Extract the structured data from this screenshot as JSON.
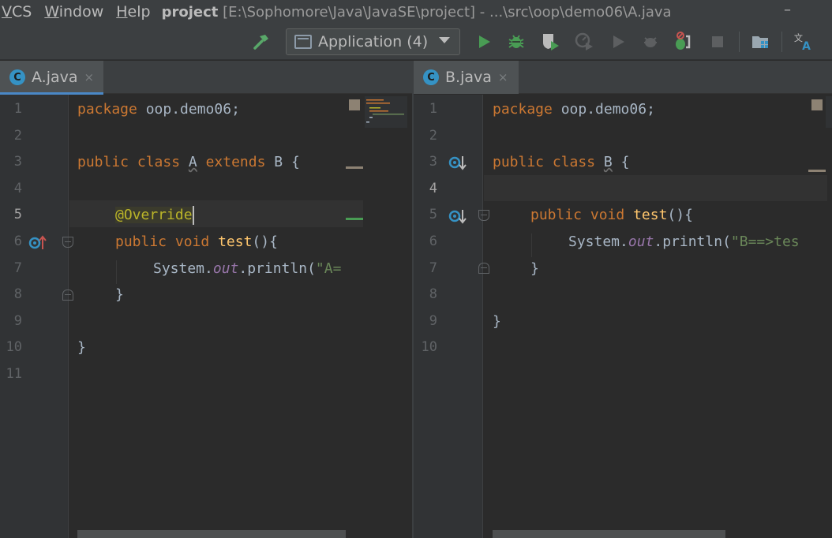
{
  "menu": {
    "items": [
      {
        "first": "V",
        "rest": "CS"
      },
      {
        "first": "W",
        "rest": "indow"
      },
      {
        "first": "H",
        "rest": "elp"
      }
    ],
    "project_name": "project",
    "title_path": "[E:\\Sophomore\\Java\\JavaSE\\project] - ...\\src\\oop\\demo06\\A.java",
    "minimize": "–"
  },
  "toolbar": {
    "run_config_label": "Application (4)"
  },
  "left_editor": {
    "tab_label": "A.java",
    "tab_icon_letter": "C",
    "tab_close": "×",
    "line_numbers": [
      "1",
      "2",
      "3",
      "4",
      "5",
      "6",
      "7",
      "8",
      "9",
      "10",
      "11"
    ],
    "active_line": "5",
    "code": {
      "l1_kw": "package",
      "l1_rest": " oop.demo06;",
      "l3_kw1": "public class",
      "l3_cls": "A",
      "l3_kw2": "extends",
      "l3_rest": " B {",
      "l5_ann": "@Override",
      "l6_kw": "public void",
      "l6_fn": "test",
      "l6_rest": "(){",
      "l7_sys": "System.",
      "l7_out": "out",
      "l7_call": ".println(",
      "l7_str": "\"A=",
      "l8": "}",
      "l10": "}"
    }
  },
  "right_editor": {
    "tab_label": "B.java",
    "tab_icon_letter": "C",
    "tab_close": "×",
    "line_numbers": [
      "1",
      "2",
      "3",
      "4",
      "5",
      "6",
      "7",
      "8",
      "9",
      "10"
    ],
    "active_line": "4",
    "code": {
      "l1_kw": "package",
      "l1_rest": " oop.demo06;",
      "l3_kw": "public class",
      "l3_cls": "B",
      "l3_rest": " {",
      "l5_kw": "public void",
      "l5_fn": "test",
      "l5_rest": "(){",
      "l6_sys": "System.",
      "l6_out": "out",
      "l6_call": ".println(",
      "l6_str": "\"B==>tes",
      "l7": "}",
      "l9": "}"
    }
  },
  "colors": {
    "keyword": "#cc7832",
    "function": "#ffc66d",
    "string": "#6a8759",
    "static_field": "#9876aa",
    "annotation": "#bbb529",
    "plain": "#a9b7c6",
    "tab_accent": "#4a88c7",
    "class_icon": "#3592c4"
  }
}
